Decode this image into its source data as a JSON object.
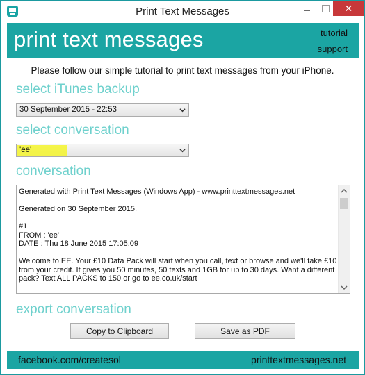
{
  "window": {
    "title": "Print Text Messages",
    "close_glyph": "✕"
  },
  "header": {
    "brand": "print text messages",
    "links": [
      "tutorial",
      "support"
    ]
  },
  "intro": "Please follow our simple tutorial to print text messages from your iPhone.",
  "backup": {
    "label": "select iTunes backup",
    "selected": "30 September 2015 - 22:53"
  },
  "conversation_select": {
    "label": "select conversation",
    "selected": "'ee'",
    "highlight_color": "#f4f52c"
  },
  "conversation": {
    "label": "conversation",
    "lines": [
      "Generated with Print Text Messages (Windows App) - www.printtextmessages.net",
      "",
      "Generated on 30 September 2015.",
      "",
      "#1",
      "FROM : 'ee'",
      "DATE : Thu 18 June 2015 17:05:09",
      "",
      "Welcome to EE. Your £10 Data Pack will start when you call, text or browse and we'll take £10 from your credit. It gives you 50 minutes, 50 texts and 1GB for up to 30 days. Want a different pack? Text ALL PACKS to 150 or go to ee.co.uk/start"
    ]
  },
  "export": {
    "label": "export conversation",
    "copy_label": "Copy to Clipboard",
    "pdf_label": "Save as PDF"
  },
  "footer": {
    "left": "facebook.com/createsol",
    "right": "printtextmessages.net"
  },
  "colors": {
    "accent": "#1ba5a3",
    "label": "#6fd1cd",
    "close": "#c7383a"
  }
}
